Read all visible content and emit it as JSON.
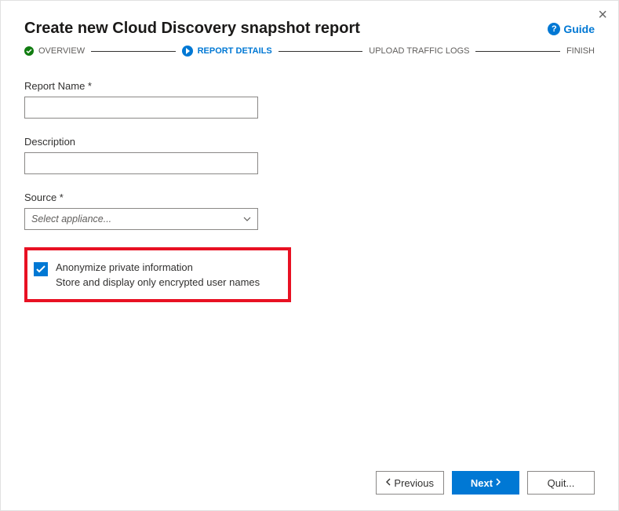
{
  "title": "Create new Cloud Discovery snapshot report",
  "guide_label": "Guide",
  "stepper": {
    "overview": "OVERVIEW",
    "report_details": "REPORT DETAILS",
    "upload_traffic_logs": "UPLOAD TRAFFIC LOGS",
    "finish": "FINISH"
  },
  "fields": {
    "report_name_label": "Report Name *",
    "report_name_value": "",
    "description_label": "Description",
    "description_value": "",
    "source_label": "Source *",
    "source_placeholder": "Select appliance..."
  },
  "anonymize": {
    "checked": true,
    "label": "Anonymize private information",
    "description": "Store and display only encrypted user names"
  },
  "footer": {
    "previous": "Previous",
    "next": "Next",
    "quit": "Quit..."
  }
}
